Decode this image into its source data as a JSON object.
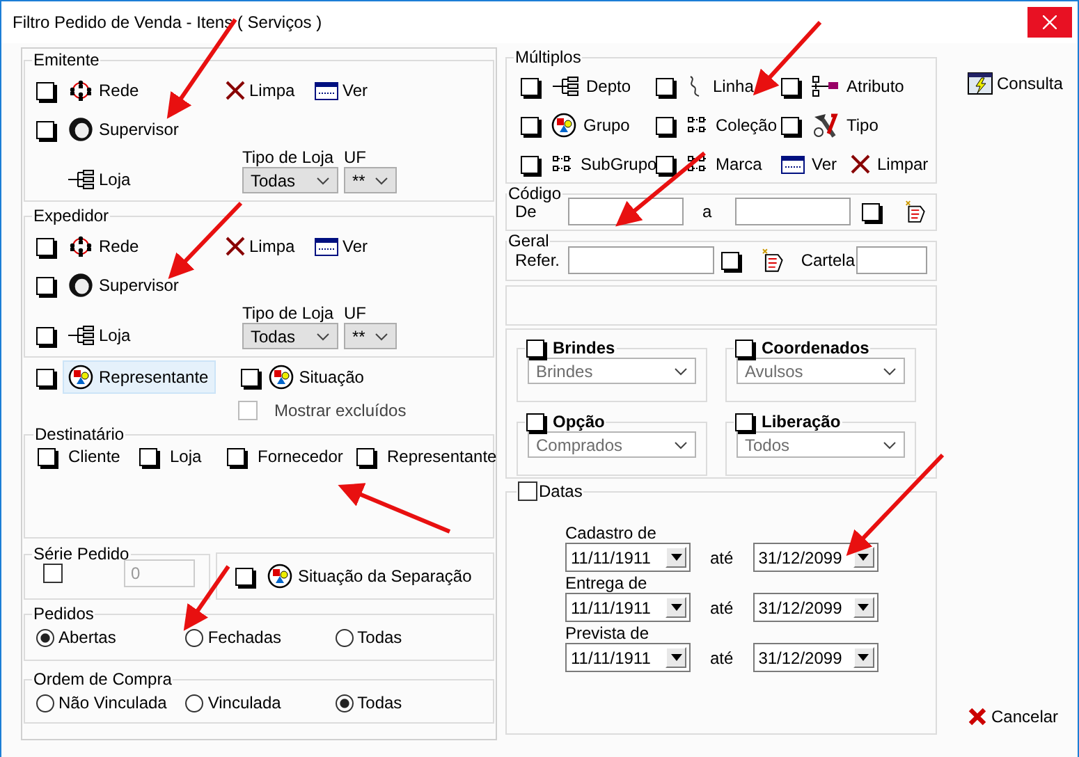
{
  "window": {
    "title": "Filtro Pedido de Venda - Itens ( Serviços )"
  },
  "emitente": {
    "title": "Emitente",
    "rede": {
      "label": "Rede",
      "checked": false
    },
    "limpa": "Limpa",
    "ver": "Ver",
    "supervisor": {
      "label": "Supervisor",
      "checked": false
    },
    "loja": {
      "label": "Loja"
    },
    "tipo_de_loja": {
      "label": "Tipo de Loja",
      "value": "Todas"
    },
    "uf": {
      "label": "UF",
      "value": "**"
    }
  },
  "expedidor": {
    "title": "Expedidor",
    "rede": {
      "label": "Rede",
      "checked": false
    },
    "limpa": "Limpa",
    "ver": "Ver",
    "supervisor": {
      "label": "Supervisor",
      "checked": false
    },
    "loja": {
      "label": "Loja",
      "checked": false
    },
    "tipo_de_loja": {
      "label": "Tipo de Loja",
      "value": "Todas"
    },
    "uf": {
      "label": "UF",
      "value": "**"
    }
  },
  "representante": {
    "label": "Representante",
    "checked": false,
    "focused": true
  },
  "situacao": {
    "label": "Situação",
    "checked": false
  },
  "mostrar_excluidos": {
    "label": "Mostrar excluídos",
    "checked": false,
    "disabled": true
  },
  "destinatario": {
    "title": "Destinatário",
    "options": [
      {
        "label": "Cliente",
        "checked": false
      },
      {
        "label": "Loja",
        "checked": false
      },
      {
        "label": "Fornecedor",
        "checked": false
      },
      {
        "label": "Representante",
        "checked": false
      }
    ]
  },
  "serie_pedido": {
    "title": "Série Pedido",
    "checked": false,
    "value": "0",
    "disabled": true
  },
  "situacao_separacao": {
    "label": "Situação da Separação",
    "checked": false
  },
  "pedidos": {
    "title": "Pedidos",
    "options": [
      {
        "label": "Abertas",
        "selected": true
      },
      {
        "label": "Fechadas",
        "selected": false
      },
      {
        "label": "Todas",
        "selected": false
      }
    ]
  },
  "ordem_de_compra": {
    "title": "Ordem de Compra",
    "options": [
      {
        "label": "Não Vinculada",
        "selected": false
      },
      {
        "label": "Vinculada",
        "selected": false
      },
      {
        "label": "Todas",
        "selected": true
      }
    ]
  },
  "multiplos": {
    "title": "Múltiplos",
    "items": [
      {
        "kind": "check",
        "label": "Depto",
        "checked": false
      },
      {
        "kind": "check",
        "label": "Linha",
        "checked": false
      },
      {
        "kind": "check",
        "label": "Atributo",
        "checked": false
      },
      {
        "kind": "check",
        "label": "Grupo",
        "checked": false
      },
      {
        "kind": "check",
        "label": "Coleção",
        "checked": false
      },
      {
        "kind": "check",
        "label": "Tipo",
        "checked": false
      },
      {
        "kind": "check",
        "label": "SubGrupo",
        "checked": false
      },
      {
        "kind": "check",
        "label": "Marca",
        "checked": false
      },
      {
        "kind": "action",
        "label": "Ver"
      },
      {
        "kind": "action",
        "label": "Limpar"
      }
    ]
  },
  "codigo": {
    "title": "Código",
    "from_label": "De",
    "to_label": "a",
    "checked": false
  },
  "geral": {
    "title": "Geral",
    "refer_label": "Refer.",
    "checked": false,
    "cartela_label": "Cartela"
  },
  "options": [
    {
      "label": "Brindes",
      "checked": false,
      "value": "Brindes"
    },
    {
      "label": "Coordenados",
      "checked": false,
      "value": "Avulsos"
    },
    {
      "label": "Opção",
      "checked": false,
      "value": "Comprados"
    },
    {
      "label": "Liberação",
      "checked": false,
      "value": "Todos"
    }
  ],
  "datas": {
    "label": "Datas",
    "checked": false,
    "rows": [
      {
        "label": "Cadastro de",
        "from": "11/11/1911",
        "to_label": "até",
        "to": "31/12/2099"
      },
      {
        "label": "Entrega de",
        "from": "11/11/1911",
        "to_label": "até",
        "to": "31/12/2099"
      },
      {
        "label": "Prevista de",
        "from": "11/11/1911",
        "to_label": "até",
        "to": "31/12/2099"
      }
    ]
  },
  "buttons": {
    "consulta": "Consulta",
    "cancelar": "Cancelar"
  },
  "annotations": [
    {
      "kind": "arrow"
    },
    {
      "kind": "arrow"
    },
    {
      "kind": "arrow"
    },
    {
      "kind": "arrow"
    },
    {
      "kind": "arrow"
    },
    {
      "kind": "arrow"
    },
    {
      "kind": "arrow"
    }
  ]
}
